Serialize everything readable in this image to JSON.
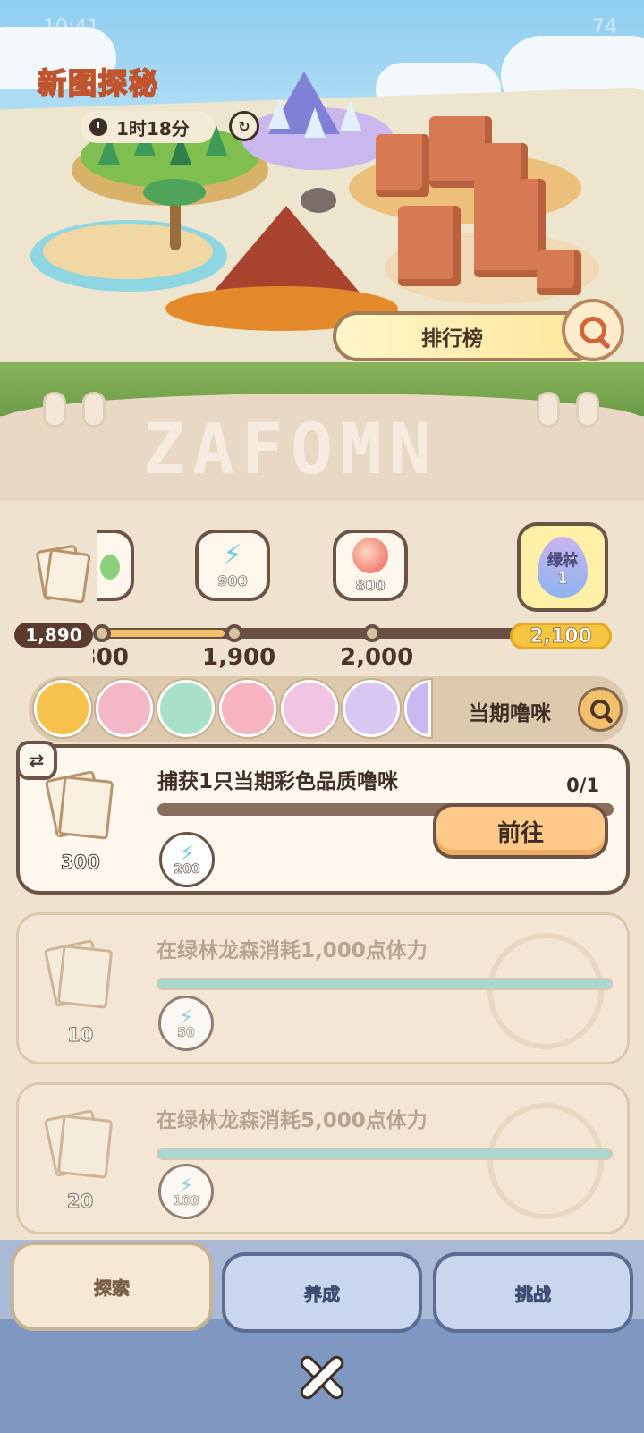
{
  "status": {
    "time": "10:41",
    "battery": "74"
  },
  "header": {
    "title": "新图探秘",
    "timer": "1时18分",
    "leaderboard_label": "排行榜"
  },
  "banner": {
    "text": "ZAFOMN"
  },
  "progress": {
    "current": "1,890",
    "goal": "2,100",
    "egg_label": "绿林",
    "egg_count": "1",
    "rewards": [
      {
        "icon": "energy-bolt-icon",
        "value": "900"
      },
      {
        "icon": "fruit-orb-icon",
        "value": "800"
      }
    ],
    "milestones": [
      "300",
      "1,900",
      "2,000"
    ],
    "fill_fraction": 0.3
  },
  "creatures": {
    "label": "当期噜咪",
    "items": [
      {
        "name": "orange-creature",
        "color": "#f6c14d"
      },
      {
        "name": "pink-creature",
        "color": "#f3b7c8"
      },
      {
        "name": "green-creature",
        "color": "#a8e0c8"
      },
      {
        "name": "rose-creature",
        "color": "#f8b3c0"
      },
      {
        "name": "lilac-creature",
        "color": "#f0c4e2"
      },
      {
        "name": "owl-creature",
        "color": "#d8c6f3"
      },
      {
        "name": "purple-creature",
        "color": "#c9b8f0"
      }
    ]
  },
  "tasks": [
    {
      "title": "捕获1只当期彩色品质噜咪",
      "count": "0/1",
      "ticket_reward": "300",
      "energy_reward": "200",
      "button": "前往",
      "progress": 0
    },
    {
      "title": "在绿林龙森消耗1,000点体力",
      "ticket_reward": "10",
      "energy_reward": "50",
      "progress": 1
    },
    {
      "title": "在绿林龙森消耗5,000点体力",
      "ticket_reward": "20",
      "energy_reward": "100",
      "progress": 1
    }
  ],
  "tabs": [
    "探索",
    "养成",
    "挑战"
  ]
}
